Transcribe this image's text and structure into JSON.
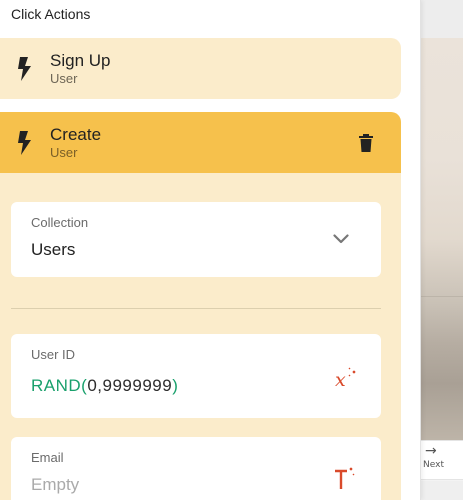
{
  "panel": {
    "title": "Click Actions"
  },
  "actions": [
    {
      "name": "Sign Up",
      "subtitle": "User",
      "icon": "bolt-icon"
    },
    {
      "name": "Create",
      "subtitle": "User",
      "icon": "bolt-icon",
      "selected": true
    }
  ],
  "create_form": {
    "collection": {
      "label": "Collection",
      "value": "Users"
    },
    "user_id": {
      "label": "User ID",
      "formula_fn": "RAND",
      "formula_open": "(",
      "formula_args": "0,9999999",
      "formula_close": ")",
      "icon": "magic-formula-icon"
    },
    "email": {
      "label": "Email",
      "placeholder": "Empty",
      "icon": "magic-text-icon"
    }
  },
  "canvas": {
    "next_label": "Next"
  },
  "colors": {
    "accent": "#f6c14c",
    "accent_light": "#fbeccb",
    "formula_green": "#19a06c",
    "magic_red": "#d94a2b"
  }
}
